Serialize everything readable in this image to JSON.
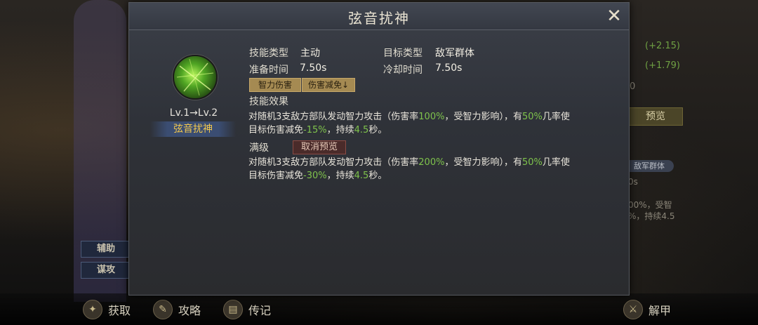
{
  "dialog": {
    "title": "弦音扰神",
    "skill_level": "Lv.1→Lv.2",
    "skill_name": "弦音扰神",
    "skill_type_label": "技能类型",
    "skill_type_value": "主动",
    "target_type_label": "目标类型",
    "target_type_value": "敌军群体",
    "prep_time_label": "准备时间",
    "prep_time_value": "7.50s",
    "cooldown_label": "冷却时间",
    "cooldown_value": "7.50s",
    "tags": [
      "智力伤害",
      "伤害减免↓"
    ],
    "effect_title": "技能效果",
    "effect_line1_a": "对随机3支敌方部队发动智力攻击（伤害率",
    "effect_line1_pct": "100%",
    "effect_line1_b": "，受智力影响），有",
    "effect_line1_chance": "50%",
    "effect_line1_c": "几率使",
    "effect_line2_a": "目标伤害减免",
    "effect_line2_pct": "-15%",
    "effect_line2_b": "，持续",
    "effect_line2_dur": "4.5",
    "effect_line2_c": "秒。",
    "max_level_title": "满级",
    "cancel_preview": "取消预览",
    "max_line1_a": "对随机3支敌方部队发动智力攻击（伤害率",
    "max_line1_pct": "200%",
    "max_line1_b": "，受智力影响），有",
    "max_line1_chance": "50%",
    "max_line1_c": "几率使",
    "max_line2_a": "目标伤害减免",
    "max_line2_pct": "-30%",
    "max_line2_b": "，持续",
    "max_line2_dur": "4.5",
    "max_line2_c": "秒。"
  },
  "background": {
    "side_tabs": [
      "辅助",
      "谋攻"
    ],
    "right_values": [
      "(+2.15)",
      "(+1.79)"
    ],
    "right_digit": "0",
    "preview_button": "预览",
    "target_chip": "敌军群体",
    "partial_sec": "0s",
    "partial_line1": "00%，受智",
    "partial_line2": "%，持续4.5"
  },
  "bottom_nav": {
    "items": [
      {
        "label": "获取",
        "icon": "acquire-icon"
      },
      {
        "label": "攻略",
        "icon": "guide-icon"
      },
      {
        "label": "传记",
        "icon": "biography-icon"
      },
      {
        "label": "解甲",
        "icon": "disarm-icon"
      }
    ]
  },
  "colors": {
    "highlight_green": "#7fc34c",
    "skill_name_gold": "#f2c84e",
    "tag_bg": "#a58a52",
    "cancel_bg": "#4a2b2a"
  }
}
